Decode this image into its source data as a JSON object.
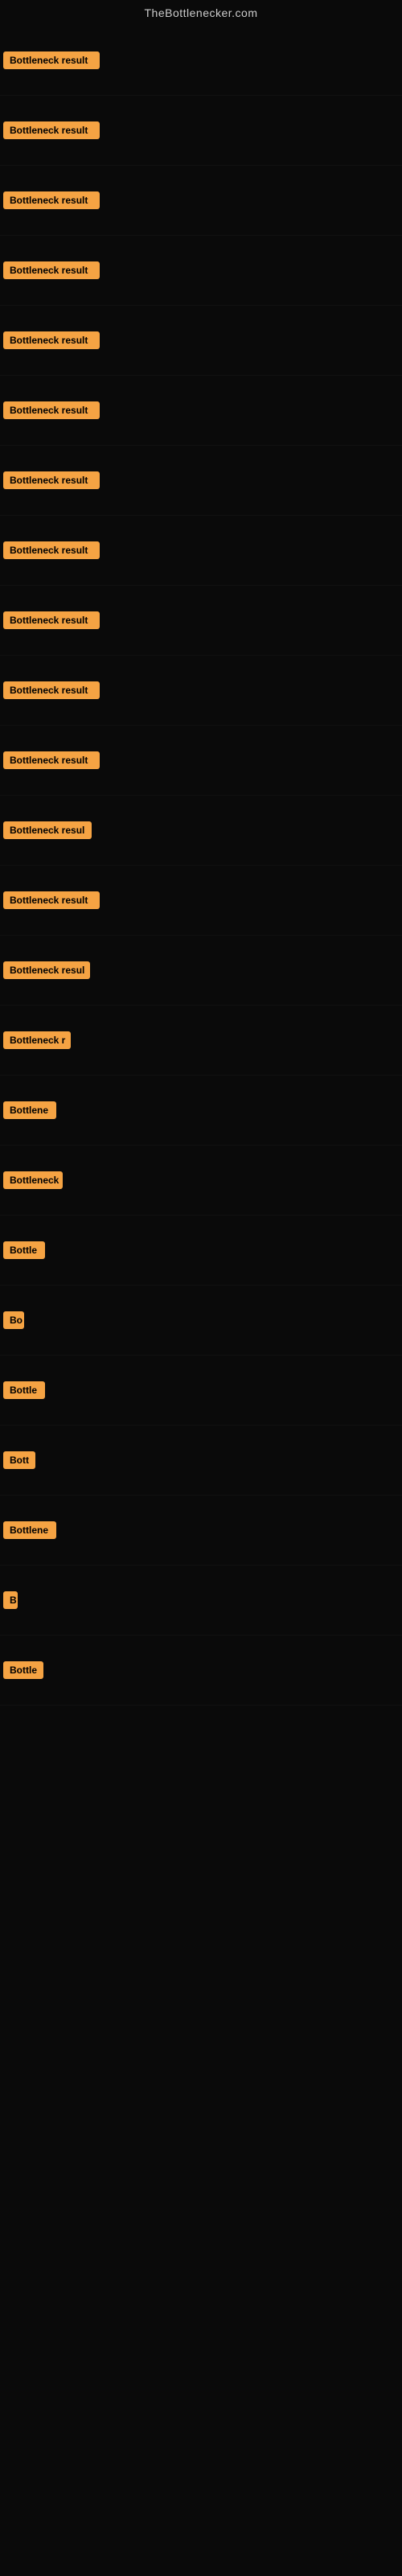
{
  "site": {
    "title": "TheBottlenecker.com"
  },
  "rows": [
    {
      "id": 1,
      "label": "Bottleneck result",
      "width": 120
    },
    {
      "id": 2,
      "label": "Bottleneck result",
      "width": 120
    },
    {
      "id": 3,
      "label": "Bottleneck result",
      "width": 120
    },
    {
      "id": 4,
      "label": "Bottleneck result",
      "width": 120
    },
    {
      "id": 5,
      "label": "Bottleneck result",
      "width": 120
    },
    {
      "id": 6,
      "label": "Bottleneck result",
      "width": 120
    },
    {
      "id": 7,
      "label": "Bottleneck result",
      "width": 120
    },
    {
      "id": 8,
      "label": "Bottleneck result",
      "width": 120
    },
    {
      "id": 9,
      "label": "Bottleneck result",
      "width": 120
    },
    {
      "id": 10,
      "label": "Bottleneck result",
      "width": 120
    },
    {
      "id": 11,
      "label": "Bottleneck result",
      "width": 120
    },
    {
      "id": 12,
      "label": "Bottleneck resul",
      "width": 110
    },
    {
      "id": 13,
      "label": "Bottleneck result",
      "width": 120
    },
    {
      "id": 14,
      "label": "Bottleneck resul",
      "width": 108
    },
    {
      "id": 15,
      "label": "Bottleneck r",
      "width": 84
    },
    {
      "id": 16,
      "label": "Bottlene",
      "width": 66
    },
    {
      "id": 17,
      "label": "Bottleneck",
      "width": 74
    },
    {
      "id": 18,
      "label": "Bottle",
      "width": 52
    },
    {
      "id": 19,
      "label": "Bo",
      "width": 26
    },
    {
      "id": 20,
      "label": "Bottle",
      "width": 52
    },
    {
      "id": 21,
      "label": "Bott",
      "width": 40
    },
    {
      "id": 22,
      "label": "Bottlene",
      "width": 66
    },
    {
      "id": 23,
      "label": "B",
      "width": 18
    },
    {
      "id": 24,
      "label": "Bottle",
      "width": 50
    }
  ],
  "colors": {
    "badge_bg": "#f5a343",
    "badge_text": "#000000",
    "bg": "#0a0a0a",
    "title_text": "#cccccc"
  }
}
